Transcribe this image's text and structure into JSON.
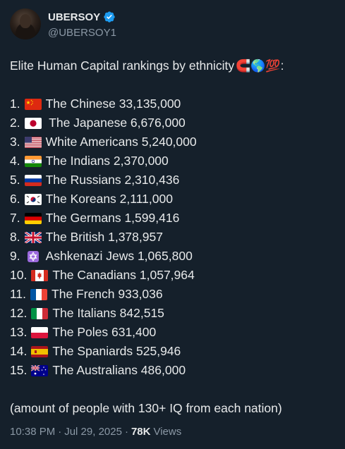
{
  "author": {
    "display_name": "UBERSOY",
    "handle": "@UBERSOY1",
    "verified_icon": "verified-badge-icon"
  },
  "post": {
    "intro_text": "Elite Human Capital rankings by ethnicity",
    "intro_emojis": "🧲🌎💯",
    "intro_colon": ":",
    "rankings": [
      {
        "rank": "1.",
        "flag": "china-flag-icon",
        "text": "The Chinese 33,135,000"
      },
      {
        "rank": "2.",
        "flag": "japan-flag-icon",
        "text": " The Japanese 6,676,000"
      },
      {
        "rank": "3.",
        "flag": "usa-flag-icon",
        "text": "White Americans 5,240,000"
      },
      {
        "rank": "4.",
        "flag": "india-flag-icon",
        "text": "The Indians 2,370,000"
      },
      {
        "rank": "5.",
        "flag": "russia-flag-icon",
        "text": "The Russians 2,310,436"
      },
      {
        "rank": "6.",
        "flag": "south-korea-flag-icon",
        "text": "The Koreans 2,111,000"
      },
      {
        "rank": "7.",
        "flag": "germany-flag-icon",
        "text": "The Germans 1,599,416"
      },
      {
        "rank": "8.",
        "flag": "uk-flag-icon",
        "text": "The British 1,378,957"
      },
      {
        "rank": "9.",
        "flag": "star-of-david-icon",
        "text": "Ashkenazi Jews 1,065,800"
      },
      {
        "rank": "10.",
        "flag": "canada-flag-icon",
        "text": "The Canadians 1,057,964"
      },
      {
        "rank": "11.",
        "flag": "france-flag-icon",
        "text": "The French 933,036"
      },
      {
        "rank": "12.",
        "flag": "italy-flag-icon",
        "text": "The Italians 842,515"
      },
      {
        "rank": "13.",
        "flag": "poland-flag-icon",
        "text": "The Poles 631,400"
      },
      {
        "rank": "14.",
        "flag": "spain-flag-icon",
        "text": "The Spaniards 525,946"
      },
      {
        "rank": "15.",
        "flag": "australia-flag-icon",
        "text": "The Australians 486,000"
      }
    ],
    "footnote": "(amount of people with 130+ IQ from each nation)"
  },
  "meta": {
    "time": "10:38 PM",
    "separator": "·",
    "date": "Jul 29, 2025",
    "views_count": "78K",
    "views_label": "Views"
  },
  "colors": {
    "background": "#15202b",
    "text": "#e7e9ea",
    "muted": "#8b98a5",
    "verified": "#1d9bf0"
  }
}
